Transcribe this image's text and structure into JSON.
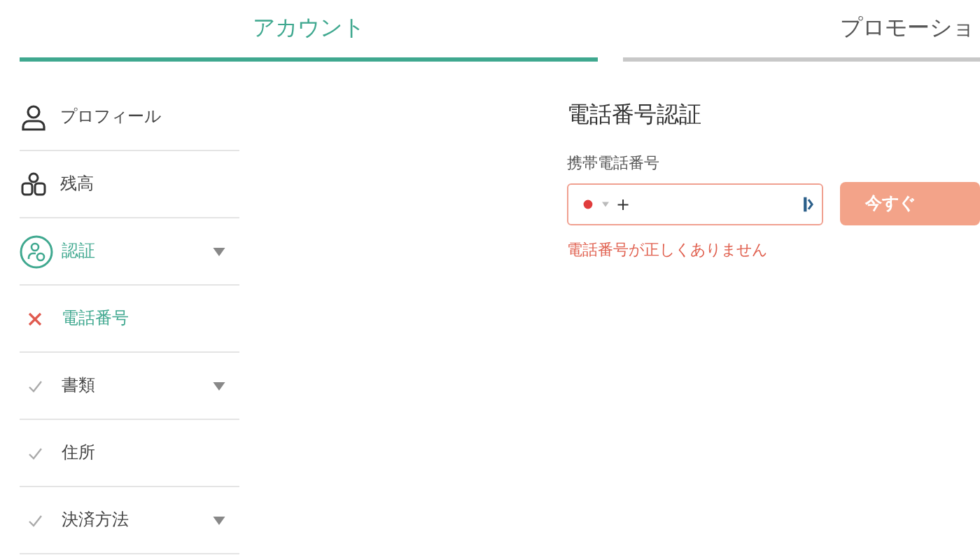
{
  "tabs": [
    {
      "label": "アカウント",
      "selected": true
    },
    {
      "label": "プロモーショ",
      "selected": false
    }
  ],
  "sidebar": {
    "items": [
      {
        "kind": "profile",
        "label": "プロフィール",
        "active": false,
        "expandable": false
      },
      {
        "kind": "balance",
        "label": "残高",
        "active": false,
        "expandable": false
      },
      {
        "kind": "verification",
        "label": "認証",
        "active": true,
        "expandable": true
      },
      {
        "kind": "step",
        "verified": false,
        "label": "電話番号",
        "active": true,
        "expandable": false
      },
      {
        "kind": "step",
        "verified": true,
        "label": "書類",
        "active": false,
        "expandable": true
      },
      {
        "kind": "step",
        "verified": true,
        "label": "住所",
        "active": false,
        "expandable": false
      },
      {
        "kind": "step",
        "verified": true,
        "label": "決済方法",
        "active": false,
        "expandable": true
      }
    ]
  },
  "phone_verification": {
    "title": "電話番号認証",
    "field_label": "携帯電話番号",
    "phone_field": {
      "value": "+",
      "invalid": true
    },
    "submit_button": "今すぐ",
    "error": "電話番号が正しくありません"
  }
}
